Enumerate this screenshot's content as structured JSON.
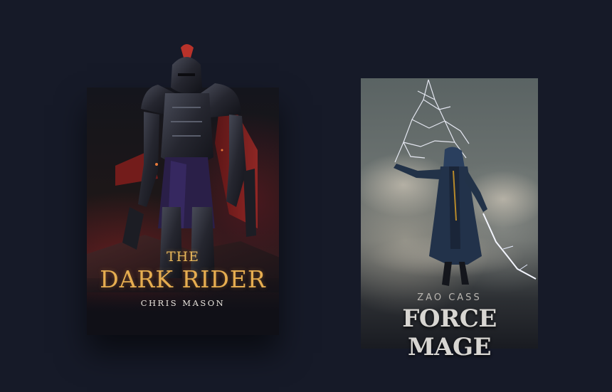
{
  "books": [
    {
      "title_prefix": "THE",
      "title": "DARK RIDER",
      "author": "CHRIS MASON",
      "accent_color": "#e6ad50",
      "artwork": "armored-knight-artwork"
    },
    {
      "title": "FORCE MAGE",
      "author": "ZAO CASS",
      "accent_color": "#d8d6d2",
      "artwork": "lightning-mage-artwork"
    }
  ]
}
